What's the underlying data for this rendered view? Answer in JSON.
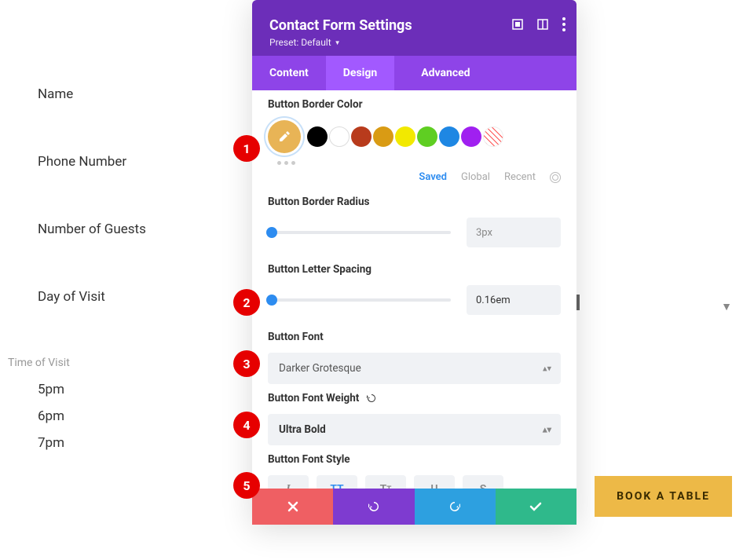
{
  "form": {
    "fields": [
      "Name",
      "Phone Number",
      "Number of Guests",
      "Day of Visit"
    ],
    "radio_label": "Time of Visit",
    "radio_options": [
      "5pm",
      "6pm",
      "7pm"
    ]
  },
  "modal": {
    "title": "Contact Form Settings",
    "preset_label": "Preset: Default",
    "tabs": {
      "content": "Content",
      "design": "Design",
      "advanced": "Advanced"
    },
    "border_color": {
      "label": "Button Border Color",
      "picker_color": "#e8b456",
      "swatches": [
        "#000000",
        "#ffffff",
        "#b83b1c",
        "#d99b14",
        "#f2e900",
        "#5fce22",
        "#1e87e3",
        "#a020f0",
        "transparent"
      ],
      "tabs": {
        "saved": "Saved",
        "global": "Global",
        "recent": "Recent"
      }
    },
    "border_radius": {
      "label": "Button Border Radius",
      "value": "3px"
    },
    "letter_spacing": {
      "label": "Button Letter Spacing",
      "value": "0.16em"
    },
    "font": {
      "label": "Button Font",
      "value": "Darker Grotesque"
    },
    "font_weight": {
      "label": "Button Font Weight",
      "value": "Ultra Bold"
    },
    "font_style": {
      "label": "Button Font Style",
      "options": {
        "italic": "I",
        "uppercase": "TT",
        "smallcaps": "Tᴛ",
        "underline": "U",
        "strike": "S"
      }
    }
  },
  "annotations": [
    "1",
    "2",
    "3",
    "4",
    "5"
  ],
  "book_button": "BOOK A TABLE"
}
